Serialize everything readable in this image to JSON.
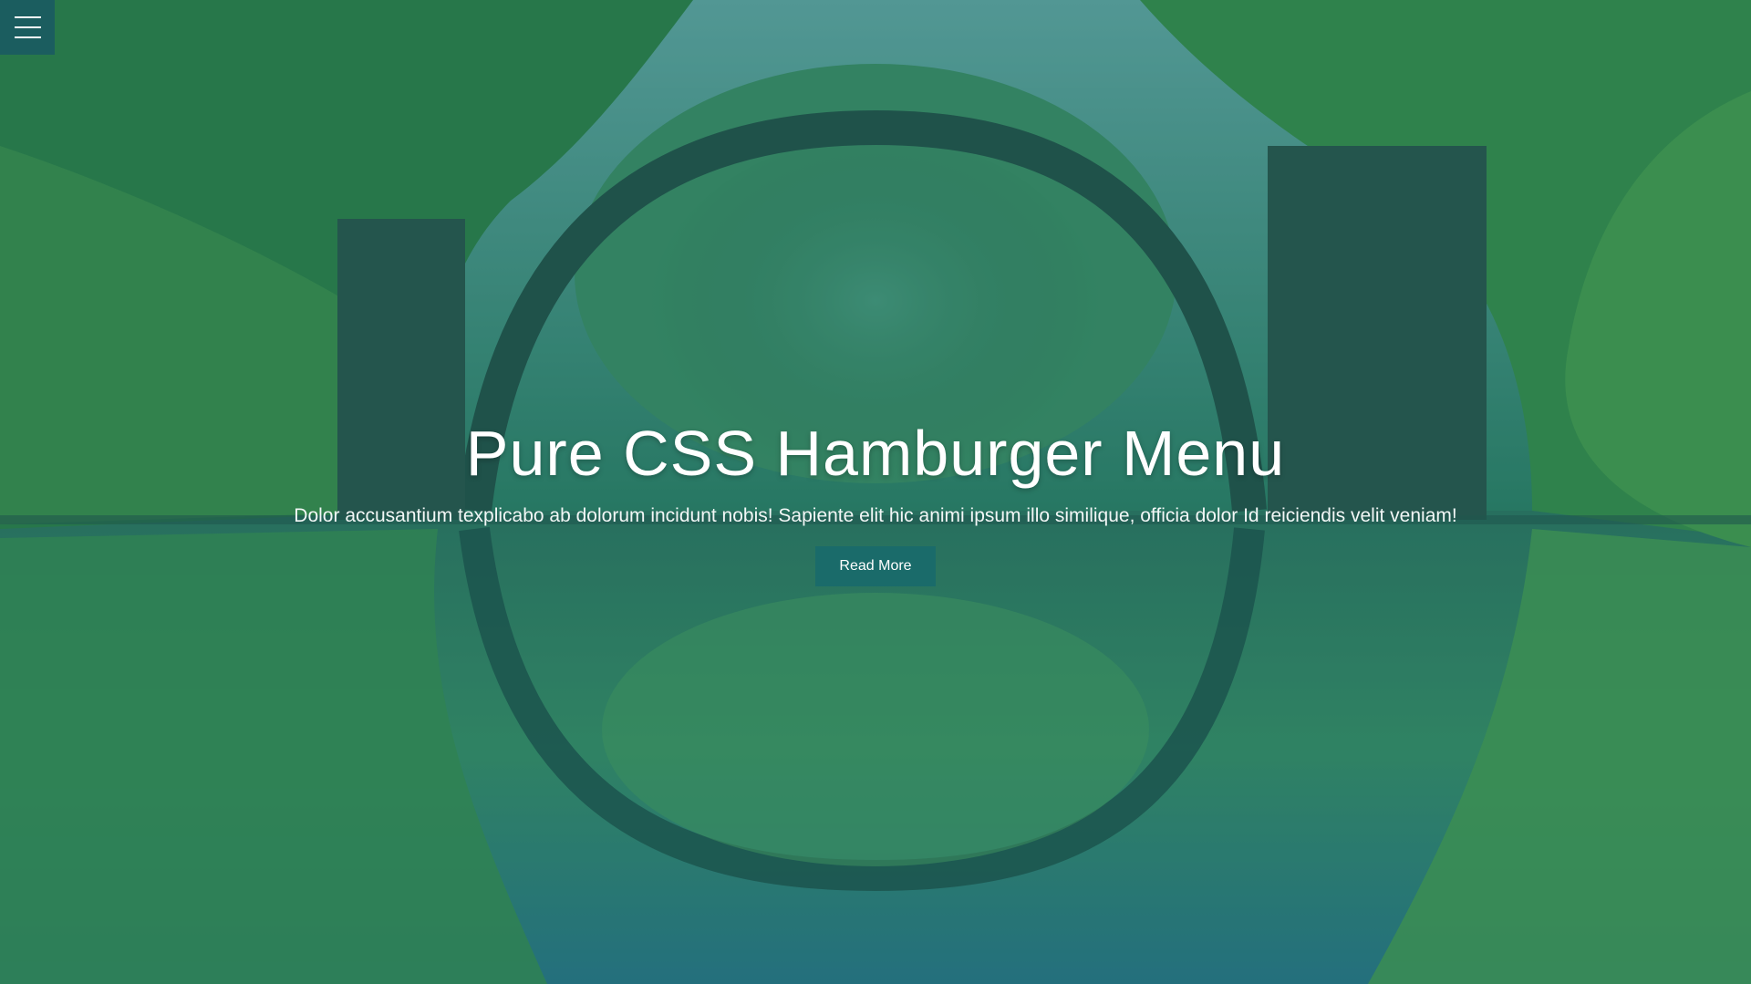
{
  "menu": {
    "icon": "hamburger-icon",
    "color": "#1b5d5f"
  },
  "hero": {
    "title": "Pure CSS Hamburger Menu",
    "text": "Dolor accusantium texplicabo ab dolorum incidunt nobis! Sapiente elit hic animi ipsum illo similique, officia dolor Id reiciendis velit veniam!",
    "button_label": "Read More",
    "button_color": "#1a6b6a",
    "background_image": "forest-arch-bridge-reflected-in-lake"
  }
}
